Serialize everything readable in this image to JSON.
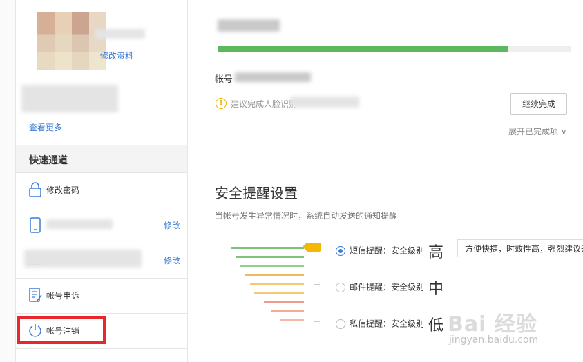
{
  "sidebar": {
    "edit_profile": "修改资料",
    "view_more": "查看更多",
    "quick_access_title": "快速通道",
    "items": [
      {
        "label": "修改密码",
        "icon": "lock-icon"
      },
      {
        "label": "",
        "icon": "phone-icon",
        "edit": "修改"
      },
      {
        "label": "",
        "icon": "email-icon",
        "edit": "修改"
      },
      {
        "label": "帐号申诉",
        "icon": "appeal-icon"
      },
      {
        "label": "帐号注销",
        "icon": "power-icon"
      }
    ]
  },
  "main": {
    "progress": 0.82,
    "account_label": "帐号",
    "warning_text": "建议完成人脸识别",
    "continue_button": "继续完成",
    "expand_link": "展开已完成项 ∨",
    "alert_settings": {
      "title": "安全提醒设置",
      "subtitle": "当帐号发生异常情况时，系统自动发送的通知提醒",
      "options": [
        {
          "label": "短信提醒：安全级别",
          "level": "高",
          "selected": true
        },
        {
          "label": "邮件提醒：安全级别",
          "level": "中",
          "selected": false
        },
        {
          "label": "私信提醒：安全级别",
          "level": "低",
          "selected": false
        }
      ],
      "tooltip": "方便快捷，时效性高，强烈建议开启"
    }
  },
  "watermark": {
    "text": "Bai 经验",
    "sub": "jingyan.baidu.com"
  },
  "colors": {
    "accent": "#3a7bd5",
    "progress": "#5cb85c",
    "highlight": "#e8262b",
    "flag": "#f5b800"
  }
}
